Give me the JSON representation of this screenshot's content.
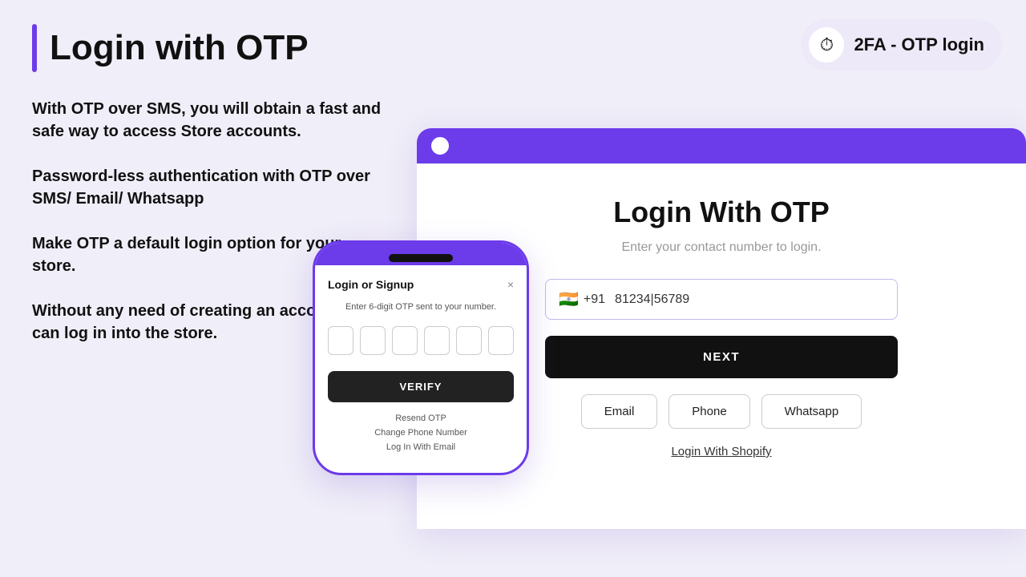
{
  "header": {
    "title": "Login with OTP",
    "badge": {
      "icon": "⏱",
      "text": "2FA - OTP login"
    }
  },
  "features": [
    "With OTP over SMS, you will obtain a fast and safe way to access Store accounts.",
    "Password-less authentication with OTP over SMS/ Email/ Whatsapp",
    "Make OTP a default login option for your store.",
    "Without any need of creating an account, you can log in into the store."
  ],
  "browser": {
    "login_title": "Login With OTP",
    "login_subtitle": "Enter your contact number to login.",
    "phone_input": {
      "flag": "🇮🇳",
      "code": "+91",
      "value": "81234|56789"
    },
    "next_button": "NEXT",
    "options": [
      "Email",
      "Phone",
      "Whatsapp"
    ],
    "shopify_link": "Login With Shopify"
  },
  "phone_modal": {
    "title": "Login or Signup",
    "close": "×",
    "subtitle": "Enter 6-digit OTP sent to your number.",
    "verify_button": "VERIFY",
    "links": [
      "Resend OTP",
      "Change Phone Number",
      "Log In With Email"
    ]
  }
}
